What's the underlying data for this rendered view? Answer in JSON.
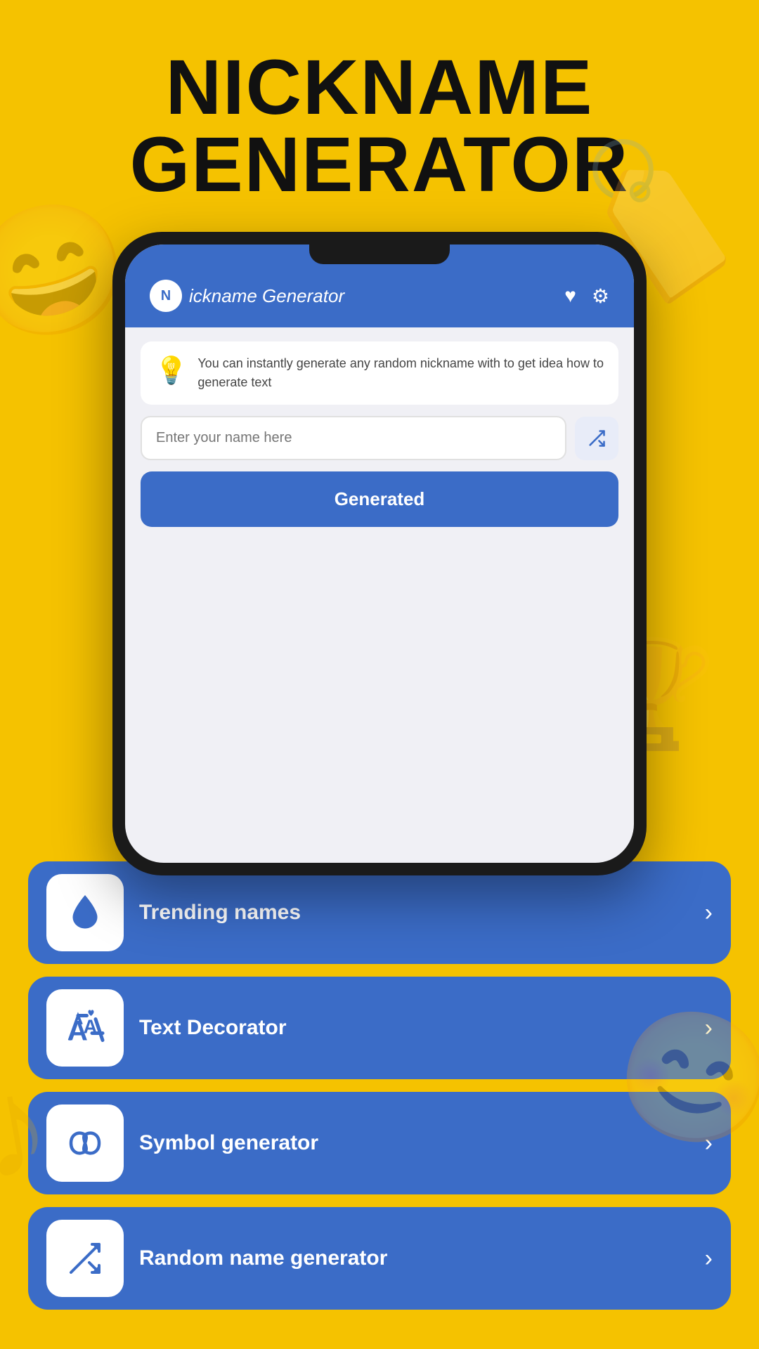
{
  "page": {
    "title": "NICKNAME\nGENERATOR",
    "background_color": "#F5C200"
  },
  "header": {
    "app_name": "ickname Generator",
    "logo_letter": "N",
    "heart_icon": "♥",
    "settings_icon": "⚙"
  },
  "info_section": {
    "icon": "💡",
    "text": "You can instantly generate any random nickname with to get idea how to generate text"
  },
  "input": {
    "placeholder": "Enter your name here"
  },
  "generate_button": {
    "label": "Generated"
  },
  "menu_items": [
    {
      "label": "Trending names",
      "icon": "droplet"
    },
    {
      "label": "Text Decorator",
      "icon": "text"
    },
    {
      "label": "Symbol generator",
      "icon": "infinity"
    },
    {
      "label": "Random name generator",
      "icon": "shuffle"
    }
  ]
}
